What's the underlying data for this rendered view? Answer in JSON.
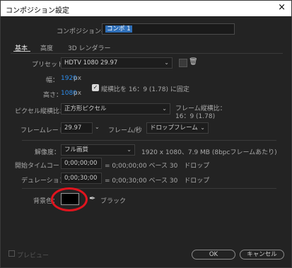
{
  "window": {
    "title": "コンポジション設定",
    "close_icon": "×"
  },
  "comp_name": {
    "label": "コンポジション名：",
    "value": "コンポ 1"
  },
  "tabs": [
    "基本",
    "高度",
    "3D レンダラー"
  ],
  "preset": {
    "label": "プリセット：",
    "value": "HDTV 1080 29.97"
  },
  "width": {
    "label": "幅：",
    "value": "1920",
    "unit": "px"
  },
  "height": {
    "label": "高さ：",
    "value": "1080",
    "unit": "px"
  },
  "aspect_lock": {
    "label": "縦横比を 16：9 (1.78) に固定",
    "checked": true
  },
  "pixel_aspect": {
    "label": "ピクセル縦横比：",
    "value": "正方形ピクセル"
  },
  "frame_aspect": {
    "label": "フレーム縦横比：",
    "value": "16：9 (1.78)"
  },
  "frame_rate": {
    "label": "フレームレート：",
    "value": "29.97",
    "unit": "フレーム/秒",
    "mode": "ドロップフレーム"
  },
  "resolution": {
    "label": "解像度：",
    "value": "フル画質",
    "info": "1920 x 1080、7.9 MB (8bpcフレームあたり)"
  },
  "start_timecode": {
    "label": "開始タイムコード：",
    "value": "0;00;00;00",
    "info": "= 0;00;00;00 ベース 30　ドロップ"
  },
  "duration": {
    "label": "デュレーション：",
    "value": "0;00;30;00",
    "info": "= 0;00;30;00 ベース 30　ドロップ"
  },
  "background": {
    "label": "背景色：",
    "color_name": "ブラック",
    "color": "#000000",
    "highlight": "#e0141e"
  },
  "preview": {
    "label": "プレビュー",
    "checked": false
  },
  "buttons": {
    "ok": "OK",
    "cancel": "キャンセル"
  }
}
